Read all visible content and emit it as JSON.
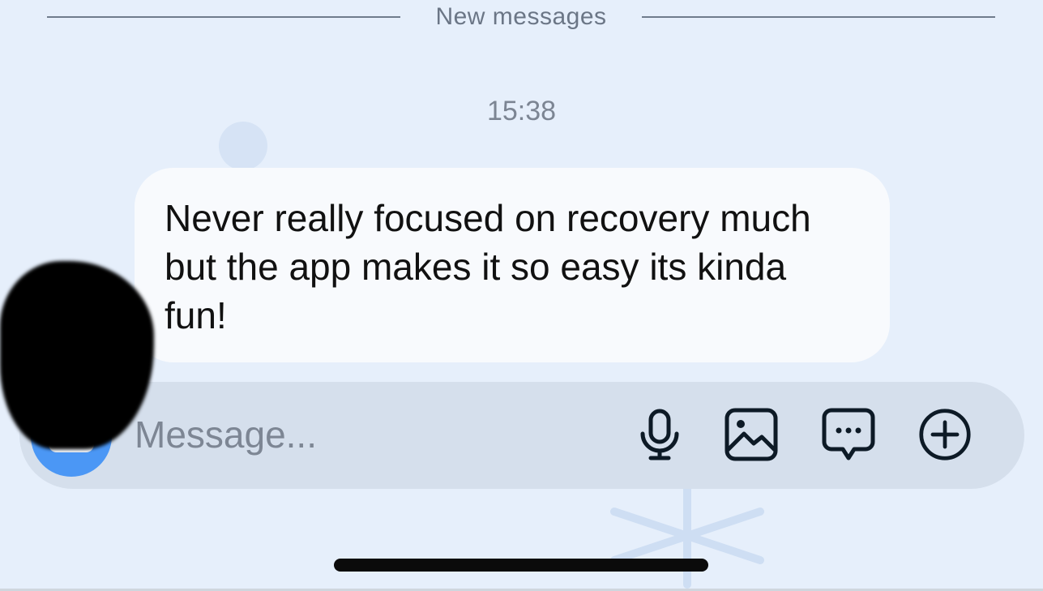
{
  "divider": {
    "label": "New messages"
  },
  "timestamp": "15:38",
  "message": {
    "lines": [
      "Never really focused on recovery much",
      "but the app makes it so easy its kinda",
      "fun!"
    ]
  },
  "composer": {
    "placeholder": "Message...",
    "icons": [
      "camera-icon",
      "microphone-icon",
      "image-icon",
      "chat-bubble-icon",
      "plus-circle-icon"
    ]
  },
  "colors": {
    "background": "#e6effb",
    "bubble": "#f8fafd",
    "composer": "#d5dfec",
    "accent": "#4b97f5",
    "icon_stroke": "#0d1a26"
  }
}
